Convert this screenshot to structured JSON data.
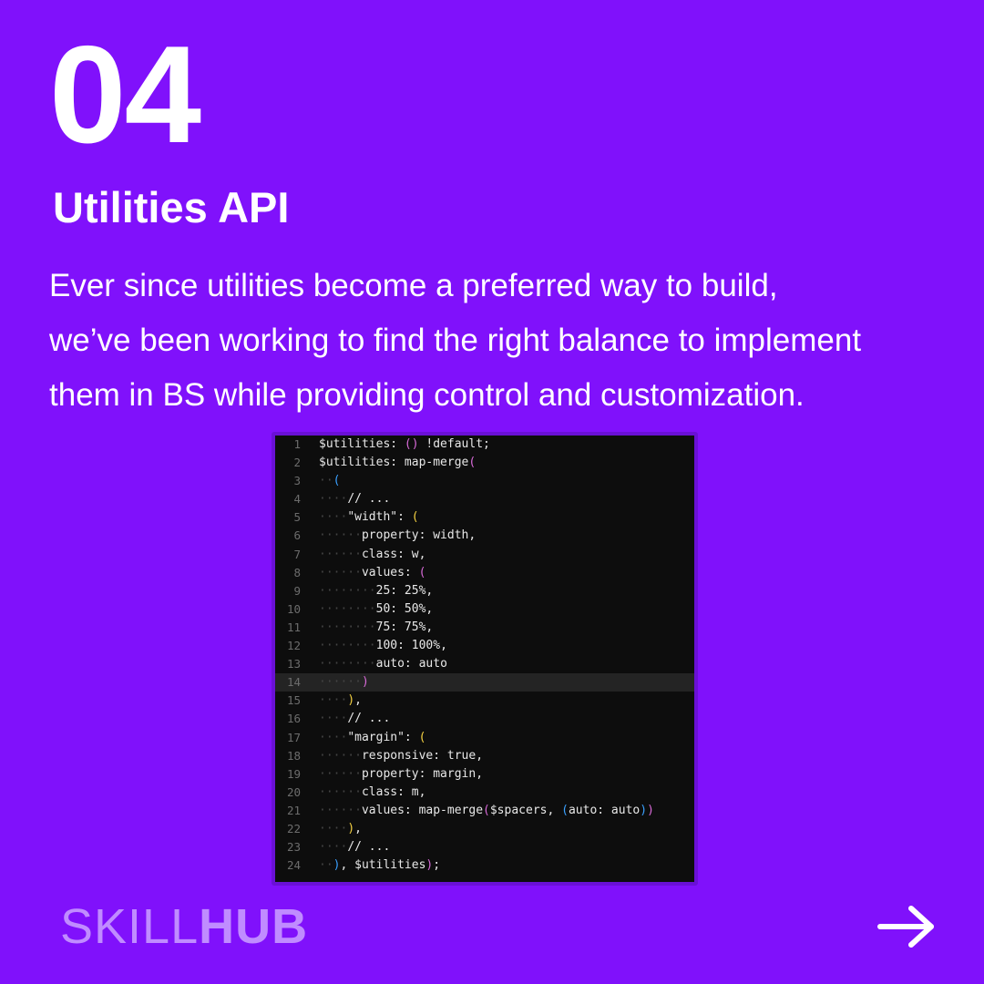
{
  "slide": {
    "number": "04",
    "title": "Utilities API",
    "description_lines": [
      "Ever since utilities become a preferred way to build,",
      "we’ve been working to find the right balance to implement",
      "them in BS while providing control and customization."
    ]
  },
  "code": {
    "line_numbers": [
      "1",
      "2",
      "3",
      "4",
      "5",
      "6",
      "7",
      "8",
      "9",
      "10",
      "11",
      "12",
      "13",
      "14",
      "15",
      "16",
      "17",
      "18",
      "19",
      "20",
      "21",
      "22",
      "23",
      "24"
    ],
    "lines": [
      "$utilities: () !default;",
      "$utilities: map-merge(",
      "  (",
      "    // ...",
      "    \"width\": (",
      "      property: width,",
      "      class: w,",
      "      values: (",
      "        25: 25%,",
      "        50: 50%,",
      "        75: 75%,",
      "        100: 100%,",
      "        auto: auto",
      "      )",
      "    ),",
      "    // ...",
      "    \"margin\": (",
      "      responsive: true,",
      "      property: margin,",
      "      class: m,",
      "      values: map-merge($spacers, (auto: auto))",
      "    ),",
      "    // ...",
      "  ), $utilities);"
    ]
  },
  "brand": {
    "logo_light": "SKILL",
    "logo_bold": "HUB"
  },
  "icons": {
    "next": "arrow-right-icon"
  },
  "colors": {
    "background": "#8011fb",
    "logo": "#c08cff",
    "code_background": "#0d0d0d"
  }
}
